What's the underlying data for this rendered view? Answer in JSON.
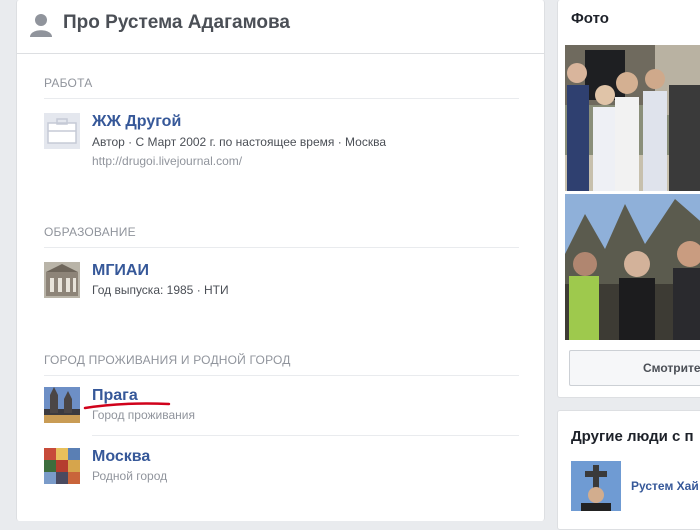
{
  "header": {
    "title": "Про Рустема Адагамова"
  },
  "work": {
    "section_title": "РАБОТА",
    "title": "ЖЖ Другой",
    "details": "Автор · С Март 2002 г. по настоящее время · Москва",
    "url": "http://drugoi.livejournal.com/"
  },
  "education": {
    "section_title": "ОБРАЗОВАНИЕ",
    "title": "МГИАИ",
    "details": "Год выпуска: 1985 · НТИ"
  },
  "places": {
    "section_title": "ГОРОД ПРОЖИВАНИЯ И РОДНОЙ ГОРОД",
    "items": [
      {
        "title": "Прага",
        "sub": "Город проживания"
      },
      {
        "title": "Москва",
        "sub": "Родной город"
      }
    ]
  },
  "photos": {
    "title": "Фото",
    "button": "Смотрите"
  },
  "people": {
    "title": "Другие люди с п",
    "name": "Рустем Хай"
  },
  "colors": {
    "link": "#365899",
    "accent_underline": "#d0021b",
    "background": "#e9ebee"
  }
}
